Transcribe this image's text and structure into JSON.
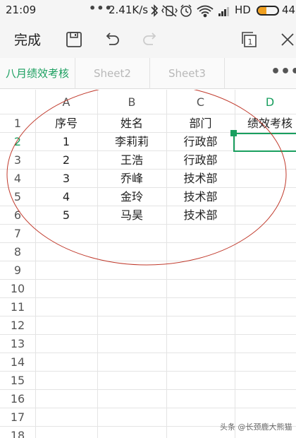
{
  "status_bar": {
    "time": "21:09",
    "dots": "•••",
    "network_speed": "2.41K/s",
    "hd_label": "HD",
    "battery_percent": "44",
    "battery_level": 0.44,
    "icons": [
      "bluetooth-icon",
      "vibrate-icon",
      "alarm-icon",
      "wifi-icon",
      "signal-icon",
      "battery-icon"
    ]
  },
  "toolbar": {
    "done_label": "完成",
    "icons": [
      "save-icon",
      "undo-icon",
      "redo-icon",
      "window-switch-icon",
      "close-icon"
    ],
    "window_count": "1"
  },
  "tabs": {
    "items": [
      {
        "label": "八月绩效考核",
        "active": true
      },
      {
        "label": "Sheet2",
        "active": false
      },
      {
        "label": "Sheet3",
        "active": false
      }
    ],
    "more_label": "•••"
  },
  "sheet": {
    "columns": [
      "A",
      "B",
      "C",
      "D"
    ],
    "selected_column": "D",
    "rows": [
      "1",
      "2",
      "3",
      "4",
      "5",
      "6",
      "7",
      "8",
      "9",
      "10",
      "11",
      "12",
      "13",
      "14",
      "15",
      "16",
      "17",
      "18"
    ],
    "selected_row": "2",
    "cells": [
      [
        "序号",
        "姓名",
        "部门",
        "绩效考核"
      ],
      [
        "1",
        "李莉莉",
        "行政部",
        ""
      ],
      [
        "2",
        "王浩",
        "行政部",
        ""
      ],
      [
        "3",
        "乔峰",
        "技术部",
        ""
      ],
      [
        "4",
        "金玲",
        "技术部",
        ""
      ],
      [
        "5",
        "马昊",
        "技术部",
        ""
      ]
    ],
    "accent_color": "#1a9f5f",
    "annotation_color": "#c0392b"
  },
  "watermark": "头条 @长颈鹿大熊猫"
}
